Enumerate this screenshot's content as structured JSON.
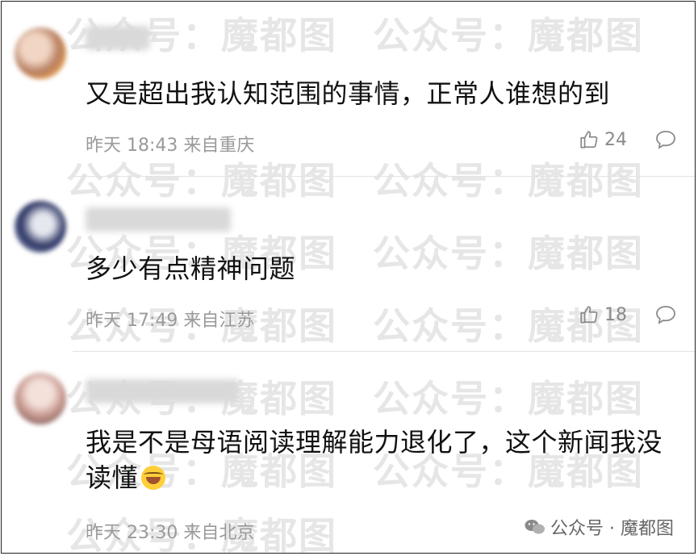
{
  "watermark": {
    "text_a": "公众号：",
    "text_b": "魔都图"
  },
  "comments": [
    {
      "text": "又是超出我认知范围的事情，正常人谁想的到",
      "time": "昨天 18:43",
      "location": "来自重庆",
      "likes": "24"
    },
    {
      "text": "多少有点精神问题",
      "time": "昨天 17:49",
      "location": "来自江苏",
      "likes": "18"
    },
    {
      "text": "我是不是母语阅读理解能力退化了，这个新闻我没读懂",
      "emoji": "laughing-tears-emoji",
      "time": "昨天 23:30",
      "location": "来自北京"
    }
  ],
  "brand": {
    "label": "公众号 · 魔都图",
    "icon": "wechat-icon"
  }
}
